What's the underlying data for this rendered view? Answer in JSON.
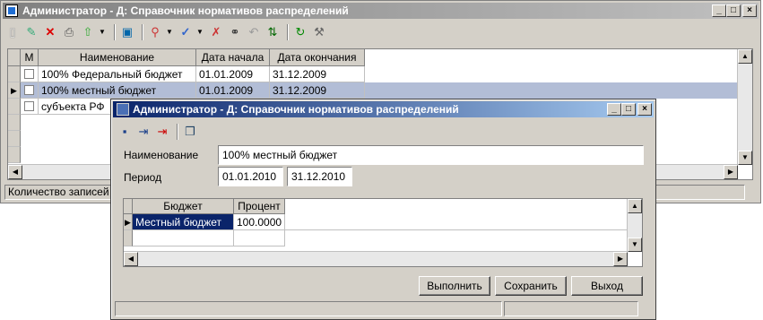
{
  "main": {
    "title": "Администратор - Д: Справочник нормативов распределений",
    "columns": [
      "М",
      "Наименование",
      "Дата начала",
      "Дата окончания"
    ],
    "rows": [
      {
        "name": "100% Федеральный бюджет",
        "start": "01.01.2009",
        "end": "31.12.2009"
      },
      {
        "name": "100% местный бюджет",
        "start": "01.01.2009",
        "end": "31.12.2009"
      },
      {
        "name": "субъекта РФ",
        "start": "",
        "end": ""
      }
    ],
    "status": "Количество записей"
  },
  "toolbar_icons": [
    "new-icon",
    "edit-icon",
    "delete-icon",
    "print-icon",
    "export-icon",
    "dropdown-icon",
    "open-icon",
    "filter-icon",
    "dropdown-icon",
    "check-icon",
    "dropdown-icon",
    "uncheck-icon",
    "search-icon",
    "undo-icon",
    "sort-icon",
    "refresh-icon",
    "tools-icon"
  ],
  "dialog": {
    "title": "Администратор - Д: Справочник нормативов распределений",
    "name_label": "Наименование",
    "name_value": "100% местный бюджет",
    "period_label": "Период",
    "period_from": "01.01.2010",
    "period_to": "31.12.2010",
    "columns": [
      "Бюджет",
      "Процент"
    ],
    "rows": [
      {
        "budget": "Местный бюджет",
        "percent": "100.0000"
      }
    ],
    "buttons": {
      "execute": "Выполнить",
      "save": "Сохранить",
      "exit": "Выход"
    }
  }
}
